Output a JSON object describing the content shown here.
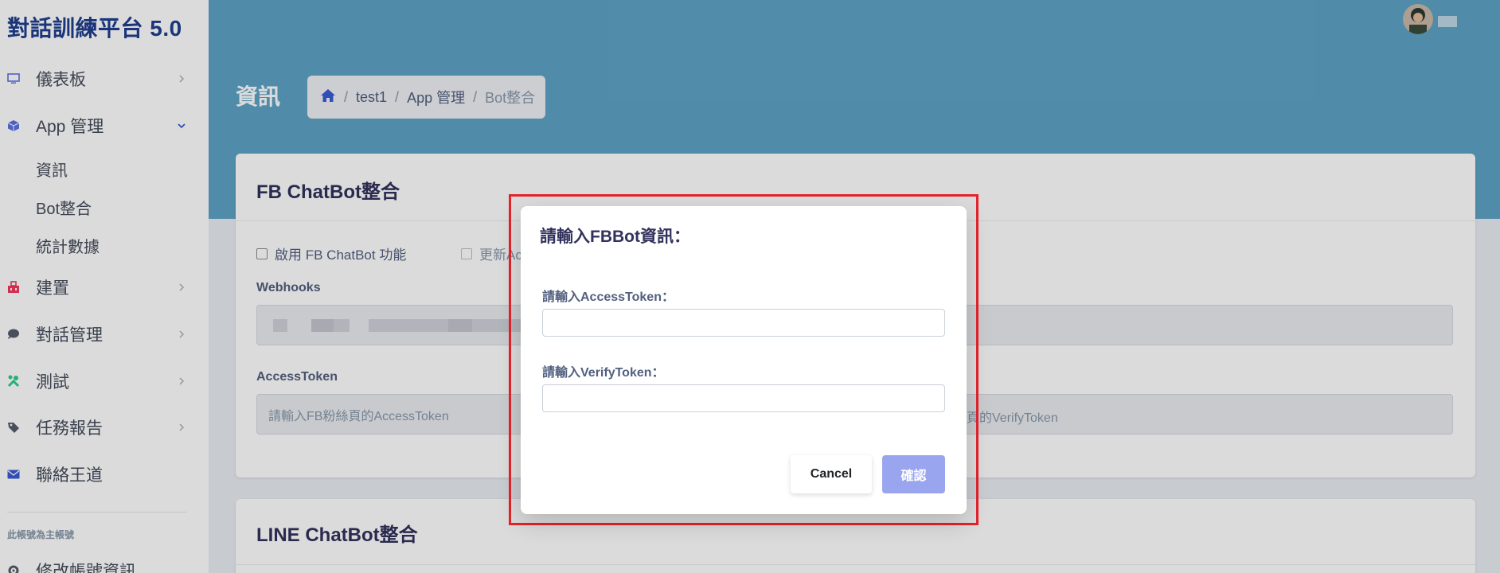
{
  "app": {
    "brand": "對話訓練平台 5.0"
  },
  "sidebar": {
    "items": [
      {
        "label": "儀表板",
        "icon": "monitor-icon"
      },
      {
        "label": "App 管理",
        "icon": "cube-icon",
        "expanded": true,
        "children": [
          {
            "label": "資訊"
          },
          {
            "label": "Bot整合"
          },
          {
            "label": "統計數據"
          }
        ]
      },
      {
        "label": "建置",
        "icon": "build-icon"
      },
      {
        "label": "對話管理",
        "icon": "chat-icon"
      },
      {
        "label": "測試",
        "icon": "tools-icon"
      },
      {
        "label": "任務報告",
        "icon": "tag-icon"
      },
      {
        "label": "聯絡王道",
        "icon": "envelope-icon"
      }
    ],
    "note": "此帳號為主帳號",
    "bottom_item": {
      "label": "修改帳號資訊",
      "icon": "gear-icon"
    }
  },
  "header": {
    "title": "資訊",
    "breadcrumb": [
      "test1",
      "App 管理",
      "Bot整合"
    ]
  },
  "fb_card": {
    "title": "FB ChatBot整合",
    "enable_label": "啟用 FB ChatBot 功能",
    "update_label": "更新Ac",
    "webhooks_label": "Webhooks",
    "access_token_label": "AccessToken",
    "access_token_placeholder": "請輸入FB粉絲頁的AccessToken",
    "verify_token_placeholder_visible": "頁的VerifyToken"
  },
  "line_card": {
    "title": "LINE ChatBot整合"
  },
  "modal": {
    "title": "請輸入FBBot資訊：",
    "access_label": "請輸入AccessToken：",
    "access_value": "",
    "verify_label": "請輸入VerifyToken：",
    "verify_value": "",
    "cancel_label": "Cancel",
    "confirm_label": "確認"
  },
  "colors": {
    "header_bg": "#5ea3c6",
    "brand": "#1f3e8e",
    "confirm_button": "#9aa5ef",
    "highlight": "#e5232b"
  }
}
